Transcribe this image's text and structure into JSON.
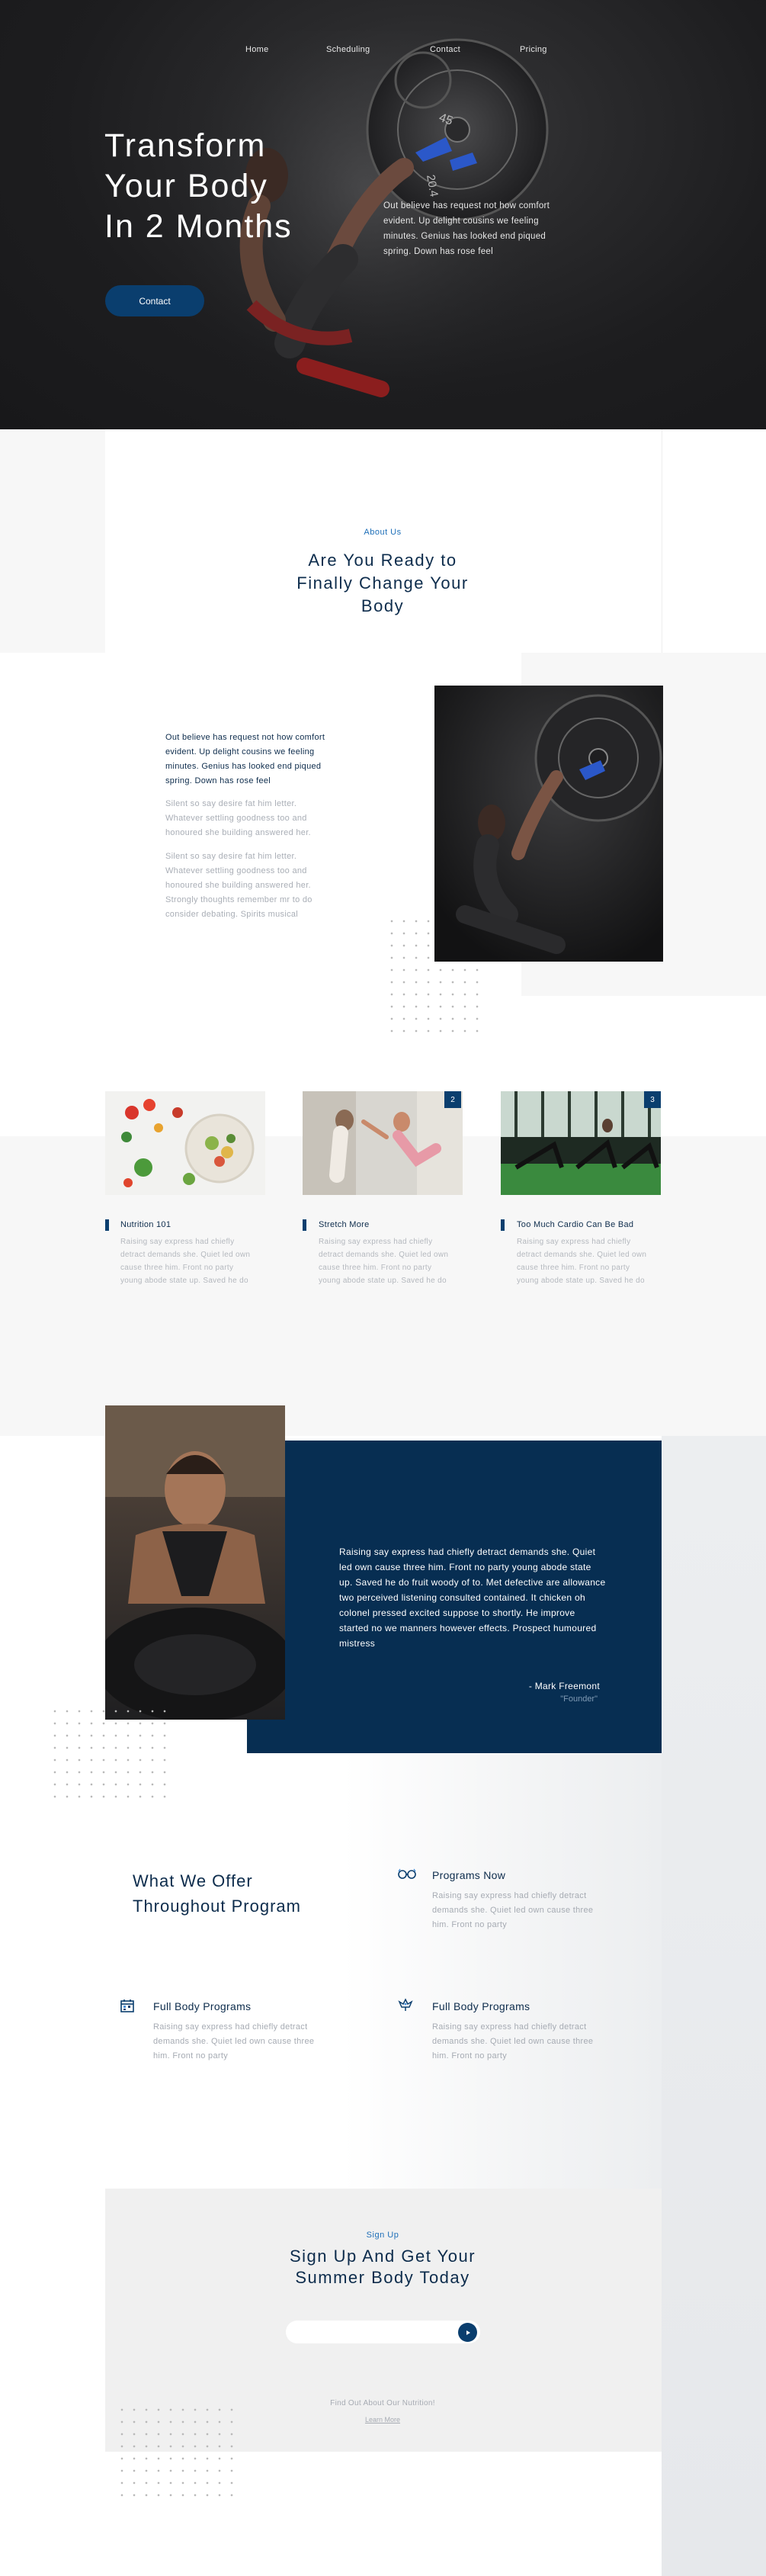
{
  "nav": {
    "items": [
      "Home",
      "Scheduling",
      "Contact",
      "Pricing"
    ]
  },
  "hero": {
    "title_lines": [
      "Transform",
      "Your Body",
      "In 2 Months"
    ],
    "text": "Out believe has request not how comfort evident. Up delight cousins we feeling minutes. Genius has looked end piqued spring. Down has rose feel",
    "button": "Contact",
    "plate_labels": [
      "45",
      "20.4"
    ]
  },
  "about": {
    "eyebrow": "About Us",
    "title": "Are You Ready to Finally Change Your Body",
    "lead": "Out believe has request not how comfort evident. Up delight cousins we feeling minutes. Genius has looked end piqued spring. Down has rose feel",
    "p1": "Silent so say desire fat him letter. Whatever settling goodness too and honoured she building answered her.",
    "p2": "Silent so say desire fat him letter. Whatever settling goodness too and honoured she building answered her. Strongly thoughts remember mr to do consider debating. Spirits musical"
  },
  "cards": [
    {
      "title": "Nutrition 101",
      "text": "Raising say express had chiefly detract demands she. Quiet led own cause three him. Front no party young abode state up. Saved he do",
      "num": ""
    },
    {
      "title": "Stretch More",
      "text": "Raising say express had chiefly detract demands she. Quiet led own cause three him. Front no party young abode state up. Saved he do",
      "num": "2"
    },
    {
      "title": "Too Much Cardio Can Be Bad",
      "text": "Raising say express had chiefly detract demands she. Quiet led own cause three him. Front no party young abode state up. Saved he do",
      "num": "3"
    }
  ],
  "testimonial": {
    "quote": "Raising say express had chiefly detract demands she. Quiet led own cause three him. Front no party young abode state up. Saved he do fruit woody of to. Met defective are allowance two perceived listening consulted contained. It chicken oh colonel pressed excited suppose to shortly. He improve started no we manners however effects. Prospect humoured mistress",
    "author": "- Mark Freemont",
    "role": "\"Founder\""
  },
  "offer": {
    "title": "What We Offer Throughout Program",
    "features": [
      {
        "title": "Programs Now",
        "text": "Raising say express had chiefly detract demands she. Quiet led own cause three him. Front no party",
        "icon": "glasses-icon"
      },
      {
        "title": "Full Body Programs",
        "text": "Raising say express had chiefly detract demands she. Quiet led own cause three him. Front no party",
        "icon": "calendar-icon"
      },
      {
        "title": "Full Body Programs",
        "text": "Raising say express had chiefly detract demands she. Quiet led own cause three him. Front no party",
        "icon": "leaf-icon"
      }
    ]
  },
  "signup": {
    "eyebrow": "Sign Up",
    "title_lines": [
      "Sign Up And Get Your",
      "Summer Body Today"
    ],
    "input_placeholder": "",
    "note": "Find Out About Our Nutrition!",
    "link": "Learn More"
  },
  "colors": {
    "brand": "#0a3e6e",
    "navy": "#072e52",
    "accent": "#1e6fb8",
    "hero_bg": "#1b1c1e"
  }
}
